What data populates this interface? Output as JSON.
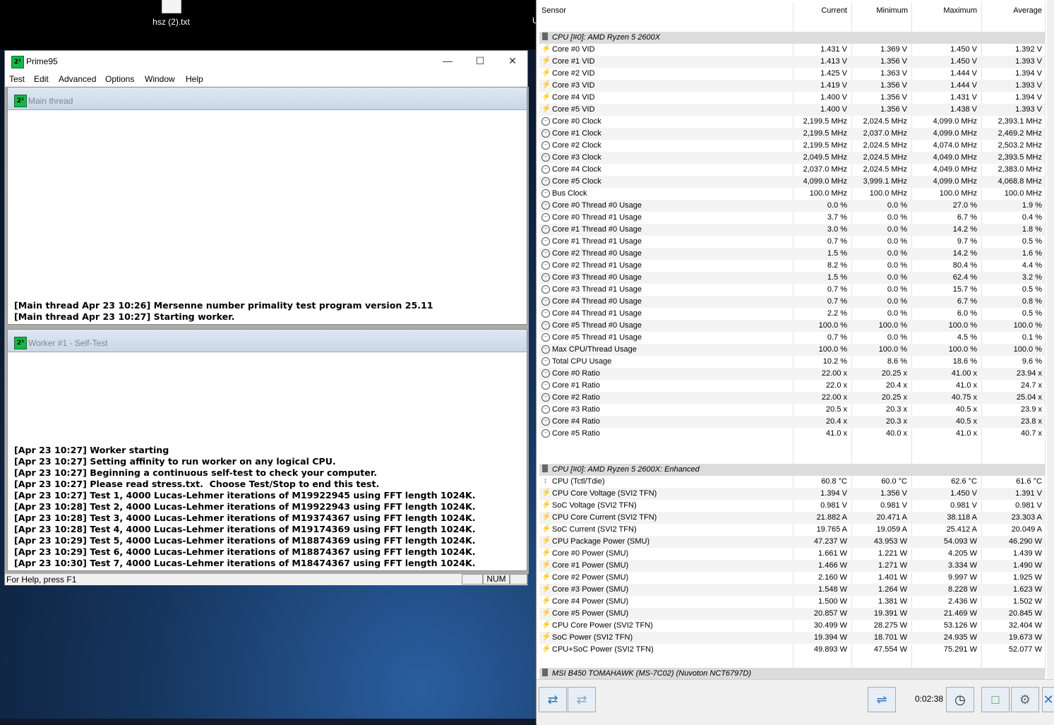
{
  "desktop": {
    "file_icon_label": "hsz (2).txt",
    "edge_label": "U"
  },
  "prime95": {
    "title": "Prime95",
    "menu": [
      "Test",
      "Edit",
      "Advanced",
      "Options",
      "Window",
      "Help"
    ],
    "main_thread": {
      "title": "Main thread",
      "log": "[Main thread Apr 23 10:26] Mersenne number primality test program version 25.11\n[Main thread Apr 23 10:27] Starting worker."
    },
    "worker": {
      "title": "Worker #1 - Self-Test",
      "log": "[Apr 23 10:27] Worker starting\n[Apr 23 10:27] Setting affinity to run worker on any logical CPU.\n[Apr 23 10:27] Beginning a continuous self-test to check your computer.\n[Apr 23 10:27] Please read stress.txt.  Choose Test/Stop to end this test.\n[Apr 23 10:27] Test 1, 4000 Lucas-Lehmer iterations of M19922945 using FFT length 1024K.\n[Apr 23 10:28] Test 2, 4000 Lucas-Lehmer iterations of M19922943 using FFT length 1024K.\n[Apr 23 10:28] Test 3, 4000 Lucas-Lehmer iterations of M19374367 using FFT length 1024K.\n[Apr 23 10:28] Test 4, 4000 Lucas-Lehmer iterations of M19174369 using FFT length 1024K.\n[Apr 23 10:29] Test 5, 4000 Lucas-Lehmer iterations of M18874369 using FFT length 1024K.\n[Apr 23 10:29] Test 6, 4000 Lucas-Lehmer iterations of M18874367 using FFT length 1024K.\n[Apr 23 10:30] Test 7, 4000 Lucas-Lehmer iterations of M18474367 using FFT length 1024K."
    },
    "status": {
      "help": "For Help, press F1",
      "num": "NUM"
    }
  },
  "hwinfo": {
    "columns": {
      "sensor": "Sensor",
      "current": "Current",
      "minimum": "Minimum",
      "maximum": "Maximum",
      "average": "Average"
    },
    "timer": "0:02:38",
    "rows": [
      {
        "type": "group",
        "name": "CPU [#0]: AMD Ryzen 5 2600X"
      },
      {
        "icon": "volt",
        "name": "Core #0 VID",
        "cur": "1.431 V",
        "min": "1.369 V",
        "max": "1.450 V",
        "avg": "1.392 V"
      },
      {
        "icon": "volt",
        "name": "Core #1 VID",
        "cur": "1.413 V",
        "min": "1.356 V",
        "max": "1.450 V",
        "avg": "1.393 V"
      },
      {
        "icon": "volt",
        "name": "Core #2 VID",
        "cur": "1.425 V",
        "min": "1.363 V",
        "max": "1.444 V",
        "avg": "1.394 V"
      },
      {
        "icon": "volt",
        "name": "Core #3 VID",
        "cur": "1.419 V",
        "min": "1.356 V",
        "max": "1.444 V",
        "avg": "1.393 V"
      },
      {
        "icon": "volt",
        "name": "Core #4 VID",
        "cur": "1.400 V",
        "min": "1.356 V",
        "max": "1.431 V",
        "avg": "1.394 V"
      },
      {
        "icon": "volt",
        "name": "Core #5 VID",
        "cur": "1.400 V",
        "min": "1.356 V",
        "max": "1.438 V",
        "avg": "1.393 V"
      },
      {
        "icon": "clk",
        "name": "Core #0 Clock",
        "cur": "2,199.5 MHz",
        "min": "2,024.5 MHz",
        "max": "4,099.0 MHz",
        "avg": "2,393.1 MHz"
      },
      {
        "icon": "clk",
        "name": "Core #1 Clock",
        "cur": "2,199.5 MHz",
        "min": "2,037.0 MHz",
        "max": "4,099.0 MHz",
        "avg": "2,469.2 MHz"
      },
      {
        "icon": "clk",
        "name": "Core #2 Clock",
        "cur": "2,199.5 MHz",
        "min": "2,024.5 MHz",
        "max": "4,074.0 MHz",
        "avg": "2,503.2 MHz"
      },
      {
        "icon": "clk",
        "name": "Core #3 Clock",
        "cur": "2,049.5 MHz",
        "min": "2,024.5 MHz",
        "max": "4,049.0 MHz",
        "avg": "2,393.5 MHz"
      },
      {
        "icon": "clk",
        "name": "Core #4 Clock",
        "cur": "2,037.0 MHz",
        "min": "2,024.5 MHz",
        "max": "4,049.0 MHz",
        "avg": "2,383.0 MHz"
      },
      {
        "icon": "clk",
        "name": "Core #5 Clock",
        "cur": "4,099.0 MHz",
        "min": "3,999.1 MHz",
        "max": "4,099.0 MHz",
        "avg": "4,068.8 MHz"
      },
      {
        "icon": "clk",
        "name": "Bus Clock",
        "cur": "100.0 MHz",
        "min": "100.0 MHz",
        "max": "100.0 MHz",
        "avg": "100.0 MHz"
      },
      {
        "icon": "clk",
        "name": "Core #0 Thread #0 Usage",
        "cur": "0.0 %",
        "min": "0.0 %",
        "max": "27.0 %",
        "avg": "1.9 %"
      },
      {
        "icon": "clk",
        "name": "Core #0 Thread #1 Usage",
        "cur": "3.7 %",
        "min": "0.0 %",
        "max": "6.7 %",
        "avg": "0.4 %"
      },
      {
        "icon": "clk",
        "name": "Core #1 Thread #0 Usage",
        "cur": "3.0 %",
        "min": "0.0 %",
        "max": "14.2 %",
        "avg": "1.8 %"
      },
      {
        "icon": "clk",
        "name": "Core #1 Thread #1 Usage",
        "cur": "0.7 %",
        "min": "0.0 %",
        "max": "9.7 %",
        "avg": "0.5 %"
      },
      {
        "icon": "clk",
        "name": "Core #2 Thread #0 Usage",
        "cur": "1.5 %",
        "min": "0.0 %",
        "max": "14.2 %",
        "avg": "1.6 %"
      },
      {
        "icon": "clk",
        "name": "Core #2 Thread #1 Usage",
        "cur": "8.2 %",
        "min": "0.0 %",
        "max": "80.4 %",
        "avg": "4.4 %"
      },
      {
        "icon": "clk",
        "name": "Core #3 Thread #0 Usage",
        "cur": "1.5 %",
        "min": "0.0 %",
        "max": "62.4 %",
        "avg": "3.2 %"
      },
      {
        "icon": "clk",
        "name": "Core #3 Thread #1 Usage",
        "cur": "0.7 %",
        "min": "0.0 %",
        "max": "15.7 %",
        "avg": "0.5 %"
      },
      {
        "icon": "clk",
        "name": "Core #4 Thread #0 Usage",
        "cur": "0.7 %",
        "min": "0.0 %",
        "max": "6.7 %",
        "avg": "0.8 %"
      },
      {
        "icon": "clk",
        "name": "Core #4 Thread #1 Usage",
        "cur": "2.2 %",
        "min": "0.0 %",
        "max": "6.0 %",
        "avg": "0.5 %"
      },
      {
        "icon": "clk",
        "name": "Core #5 Thread #0 Usage",
        "cur": "100.0 %",
        "min": "100.0 %",
        "max": "100.0 %",
        "avg": "100.0 %"
      },
      {
        "icon": "clk",
        "name": "Core #5 Thread #1 Usage",
        "cur": "0.7 %",
        "min": "0.0 %",
        "max": "4.5 %",
        "avg": "0.1 %"
      },
      {
        "icon": "clk",
        "name": "Max CPU/Thread Usage",
        "cur": "100.0 %",
        "min": "100.0 %",
        "max": "100.0 %",
        "avg": "100.0 %"
      },
      {
        "icon": "clk",
        "name": "Total CPU Usage",
        "cur": "10.2 %",
        "min": "8.6 %",
        "max": "18.6 %",
        "avg": "9.6 %"
      },
      {
        "icon": "clk",
        "name": "Core #0 Ratio",
        "cur": "22.00 x",
        "min": "20.25 x",
        "max": "41.00 x",
        "avg": "23.94 x"
      },
      {
        "icon": "clk",
        "name": "Core #1 Ratio",
        "cur": "22.0 x",
        "min": "20.4 x",
        "max": "41.0 x",
        "avg": "24.7 x"
      },
      {
        "icon": "clk",
        "name": "Core #2 Ratio",
        "cur": "22.00 x",
        "min": "20.25 x",
        "max": "40.75 x",
        "avg": "25.04 x"
      },
      {
        "icon": "clk",
        "name": "Core #3 Ratio",
        "cur": "20.5 x",
        "min": "20.3 x",
        "max": "40.5 x",
        "avg": "23.9 x"
      },
      {
        "icon": "clk",
        "name": "Core #4 Ratio",
        "cur": "20.4 x",
        "min": "20.3 x",
        "max": "40.5 x",
        "avg": "23.8 x"
      },
      {
        "icon": "clk",
        "name": "Core #5 Ratio",
        "cur": "41.0 x",
        "min": "40.0 x",
        "max": "41.0 x",
        "avg": "40.7 x"
      },
      {
        "type": "blank"
      },
      {
        "type": "blank"
      },
      {
        "type": "group",
        "name": "CPU [#0]: AMD Ryzen 5 2600X: Enhanced"
      },
      {
        "icon": "temp",
        "name": "CPU (Tctl/Tdie)",
        "cur": "60.8 °C",
        "min": "60.0 °C",
        "max": "62.6 °C",
        "avg": "61.6 °C"
      },
      {
        "icon": "volt",
        "name": "CPU Core Voltage (SVI2 TFN)",
        "cur": "1.394 V",
        "min": "1.356 V",
        "max": "1.450 V",
        "avg": "1.391 V"
      },
      {
        "icon": "volt",
        "name": "SoC Voltage (SVI2 TFN)",
        "cur": "0.981 V",
        "min": "0.981 V",
        "max": "0.981 V",
        "avg": "0.981 V"
      },
      {
        "icon": "volt",
        "name": "CPU Core Current (SVI2 TFN)",
        "cur": "21.882 A",
        "min": "20.471 A",
        "max": "38.118 A",
        "avg": "23.303 A"
      },
      {
        "icon": "volt",
        "name": "SoC Current (SVI2 TFN)",
        "cur": "19.765 A",
        "min": "19.059 A",
        "max": "25.412 A",
        "avg": "20.049 A"
      },
      {
        "icon": "volt",
        "name": "CPU Package Power (SMU)",
        "cur": "47.237 W",
        "min": "43.953 W",
        "max": "54.093 W",
        "avg": "46.290 W"
      },
      {
        "icon": "volt",
        "name": "Core #0 Power (SMU)",
        "cur": "1.661 W",
        "min": "1.221 W",
        "max": "4.205 W",
        "avg": "1.439 W"
      },
      {
        "icon": "volt",
        "name": "Core #1 Power (SMU)",
        "cur": "1.466 W",
        "min": "1.271 W",
        "max": "3.334 W",
        "avg": "1.490 W"
      },
      {
        "icon": "volt",
        "name": "Core #2 Power (SMU)",
        "cur": "2.160 W",
        "min": "1.401 W",
        "max": "9.997 W",
        "avg": "1.925 W"
      },
      {
        "icon": "volt",
        "name": "Core #3 Power (SMU)",
        "cur": "1.548 W",
        "min": "1.264 W",
        "max": "8.228 W",
        "avg": "1.623 W"
      },
      {
        "icon": "volt",
        "name": "Core #4 Power (SMU)",
        "cur": "1.500 W",
        "min": "1.381 W",
        "max": "2.436 W",
        "avg": "1.502 W"
      },
      {
        "icon": "volt",
        "name": "Core #5 Power (SMU)",
        "cur": "20.857 W",
        "min": "19.391 W",
        "max": "21.469 W",
        "avg": "20.845 W"
      },
      {
        "icon": "volt",
        "name": "CPU Core Power (SVI2 TFN)",
        "cur": "30.499 W",
        "min": "28.275 W",
        "max": "53.126 W",
        "avg": "32.404 W"
      },
      {
        "icon": "volt",
        "name": "SoC Power (SVI2 TFN)",
        "cur": "19.394 W",
        "min": "18.701 W",
        "max": "24.935 W",
        "avg": "19.673 W"
      },
      {
        "icon": "volt",
        "name": "CPU+SoC Power (SVI2 TFN)",
        "cur": "49.893 W",
        "min": "47.554 W",
        "max": "75.291 W",
        "avg": "52.077 W"
      },
      {
        "type": "blank"
      },
      {
        "type": "group",
        "name": "MSI B450 TOMAHAWK (MS-7C02) (Nuvoton NCT6797D)"
      }
    ]
  }
}
